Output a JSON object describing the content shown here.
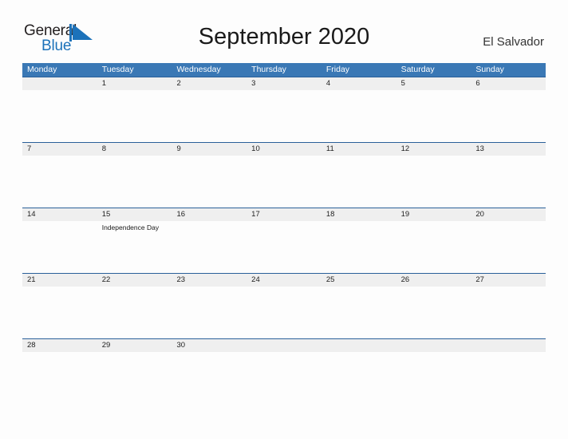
{
  "brand": {
    "name_part1": "General",
    "name_part2": "Blue",
    "flag_icon": "blue-triangle-flag-icon",
    "color_dark": "#231f20",
    "color_blue": "#1c72ba"
  },
  "header": {
    "title": "September 2020",
    "region": "El Salvador"
  },
  "theme": {
    "header_blue": "#3a78b5",
    "rule_blue": "#2a6099",
    "date_strip_gray": "#efefef",
    "page_background": "#fdfdfd"
  },
  "calendar": {
    "month": "September",
    "year": "2020",
    "weekday_headers": [
      "Monday",
      "Tuesday",
      "Wednesday",
      "Thursday",
      "Friday",
      "Saturday",
      "Sunday"
    ],
    "weeks": [
      {
        "days": [
          {
            "date": "",
            "event": ""
          },
          {
            "date": "1",
            "event": ""
          },
          {
            "date": "2",
            "event": ""
          },
          {
            "date": "3",
            "event": ""
          },
          {
            "date": "4",
            "event": ""
          },
          {
            "date": "5",
            "event": ""
          },
          {
            "date": "6",
            "event": ""
          }
        ]
      },
      {
        "days": [
          {
            "date": "7",
            "event": ""
          },
          {
            "date": "8",
            "event": ""
          },
          {
            "date": "9",
            "event": ""
          },
          {
            "date": "10",
            "event": ""
          },
          {
            "date": "11",
            "event": ""
          },
          {
            "date": "12",
            "event": ""
          },
          {
            "date": "13",
            "event": ""
          }
        ]
      },
      {
        "days": [
          {
            "date": "14",
            "event": ""
          },
          {
            "date": "15",
            "event": "Independence Day"
          },
          {
            "date": "16",
            "event": ""
          },
          {
            "date": "17",
            "event": ""
          },
          {
            "date": "18",
            "event": ""
          },
          {
            "date": "19",
            "event": ""
          },
          {
            "date": "20",
            "event": ""
          }
        ]
      },
      {
        "days": [
          {
            "date": "21",
            "event": ""
          },
          {
            "date": "22",
            "event": ""
          },
          {
            "date": "23",
            "event": ""
          },
          {
            "date": "24",
            "event": ""
          },
          {
            "date": "25",
            "event": ""
          },
          {
            "date": "26",
            "event": ""
          },
          {
            "date": "27",
            "event": ""
          }
        ]
      },
      {
        "days": [
          {
            "date": "28",
            "event": ""
          },
          {
            "date": "29",
            "event": ""
          },
          {
            "date": "30",
            "event": ""
          },
          {
            "date": "",
            "event": ""
          },
          {
            "date": "",
            "event": ""
          },
          {
            "date": "",
            "event": ""
          },
          {
            "date": "",
            "event": ""
          }
        ]
      }
    ]
  }
}
